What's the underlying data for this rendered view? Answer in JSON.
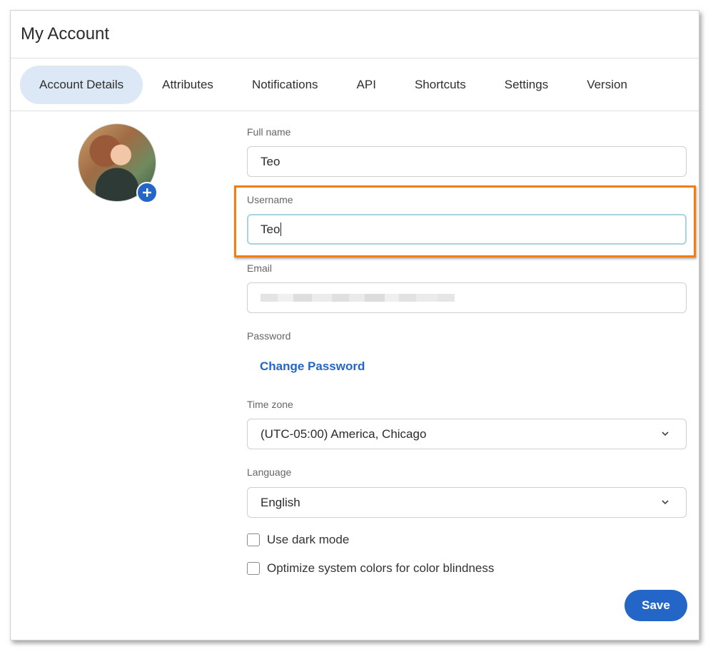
{
  "header": {
    "title": "My Account"
  },
  "tabs": [
    {
      "label": "Account Details",
      "active": true
    },
    {
      "label": "Attributes"
    },
    {
      "label": "Notifications"
    },
    {
      "label": "API"
    },
    {
      "label": "Shortcuts"
    },
    {
      "label": "Settings"
    },
    {
      "label": "Version"
    }
  ],
  "form": {
    "full_name": {
      "label": "Full name",
      "value": "Teo"
    },
    "username": {
      "label": "Username",
      "value": "Teo"
    },
    "email": {
      "label": "Email",
      "value": ""
    },
    "password": {
      "label": "Password",
      "link": "Change Password"
    },
    "time_zone": {
      "label": "Time zone",
      "value": "(UTC-05:00) America, Chicago"
    },
    "language": {
      "label": "Language",
      "value": "English"
    },
    "dark_mode": {
      "label": "Use dark mode",
      "checked": false
    },
    "color_blind": {
      "label": "Optimize system colors for color blindness",
      "checked": false
    },
    "save_label": "Save"
  },
  "colors": {
    "accent": "#2366c7",
    "active_tab_bg": "#dce8f5",
    "highlight": "#ef7e14",
    "focus_border": "#a9d4df"
  },
  "icons": {
    "add_photo": "plus-circle-icon",
    "dropdown": "chevron-down-icon"
  }
}
